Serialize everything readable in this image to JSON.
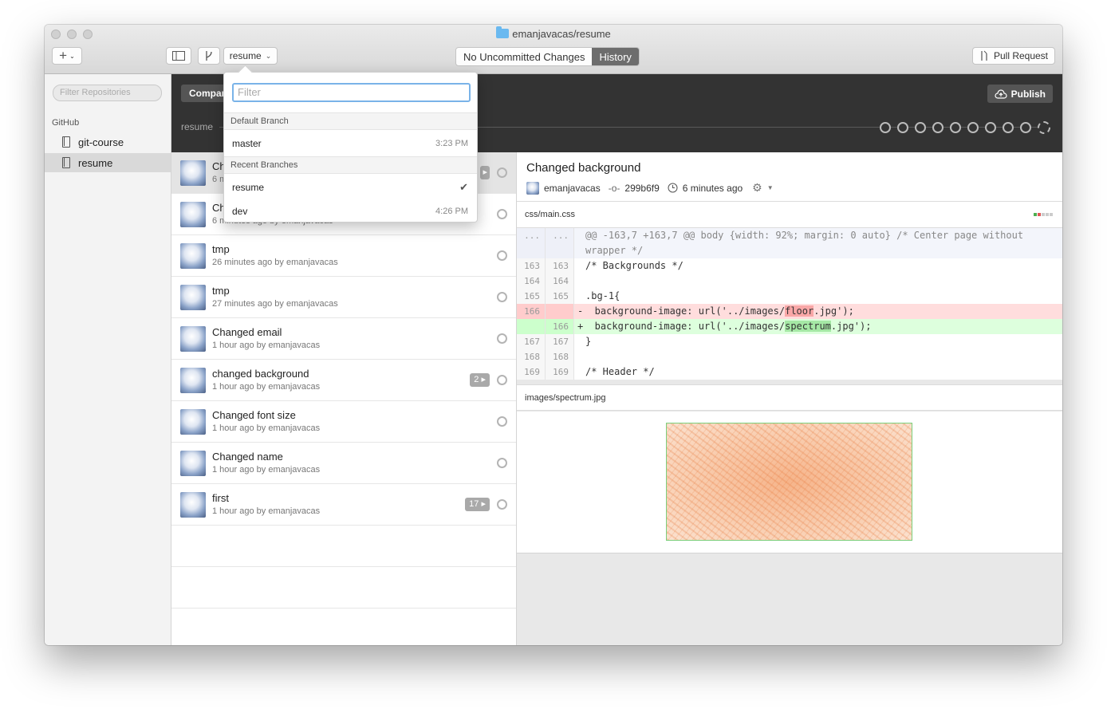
{
  "window": {
    "title": "emanjavacas/resume"
  },
  "toolbar": {
    "add_label": "+",
    "branch_label": "resume",
    "seg_uncommitted": "No Uncommitted Changes",
    "seg_history": "History",
    "pull_request_label": "Pull Request"
  },
  "sidebar": {
    "filter_placeholder": "Filter Repositories",
    "section": "GitHub",
    "repos": [
      {
        "label": "git-course"
      },
      {
        "label": "resume"
      }
    ]
  },
  "darkbar": {
    "compare_label": "Compar",
    "branch": "resume",
    "publish_label": "Publish"
  },
  "commits": [
    {
      "title": "Ch",
      "meta": "6 m",
      "badge": ""
    },
    {
      "title": "Ch",
      "meta": "6 minutes ago by emanjavacas",
      "badge": ""
    },
    {
      "title": "tmp",
      "meta": "26 minutes ago by emanjavacas",
      "badge": ""
    },
    {
      "title": "tmp",
      "meta": "27 minutes ago by emanjavacas",
      "badge": ""
    },
    {
      "title": "Changed email",
      "meta": "1 hour ago by emanjavacas",
      "badge": ""
    },
    {
      "title": "changed background",
      "meta": "1 hour ago by emanjavacas",
      "badge": "2 ▸"
    },
    {
      "title": "Changed font size",
      "meta": "1 hour ago by emanjavacas",
      "badge": ""
    },
    {
      "title": "Changed name",
      "meta": "1 hour ago by emanjavacas",
      "badge": ""
    },
    {
      "title": "first",
      "meta": "1 hour ago by emanjavacas",
      "badge": "17 ▸"
    }
  ],
  "detail": {
    "title": "Changed background",
    "author": "emanjavacas",
    "sha": "299b6f9",
    "time": "6 minutes ago",
    "file1": "css/main.css",
    "file2": "images/spectrum.jpg",
    "hunk": "@@ -163,7 +163,7 @@ body {width: 92%; margin: 0 auto} /* Center page without",
    "hunk2": "wrapper */",
    "lines": [
      {
        "a": "163",
        "b": "163",
        "code": "/* Backgrounds */"
      },
      {
        "a": "164",
        "b": "164",
        "code": ""
      },
      {
        "a": "165",
        "b": "165",
        "code": ".bg-1{"
      },
      {
        "a": "167",
        "b": "167",
        "code": "}"
      },
      {
        "a": "168",
        "b": "168",
        "code": ""
      },
      {
        "a": "169",
        "b": "169",
        "code": "/* Header */"
      }
    ],
    "del_line": {
      "a": "166",
      "pre": "-  background-image: url('../images/",
      "hl": "floor",
      "post": ".jpg');"
    },
    "add_line": {
      "b": "166",
      "pre": "+  background-image: url('../images/",
      "hl": "spectrum",
      "post": ".jpg');"
    }
  },
  "branch_popup": {
    "filter_placeholder": "Filter",
    "default_header": "Default Branch",
    "recent_header": "Recent Branches",
    "master": {
      "name": "master",
      "time": "3:23 PM"
    },
    "resume": {
      "name": "resume",
      "check": "✔"
    },
    "dev": {
      "name": "dev",
      "time": "4:26 PM"
    }
  }
}
